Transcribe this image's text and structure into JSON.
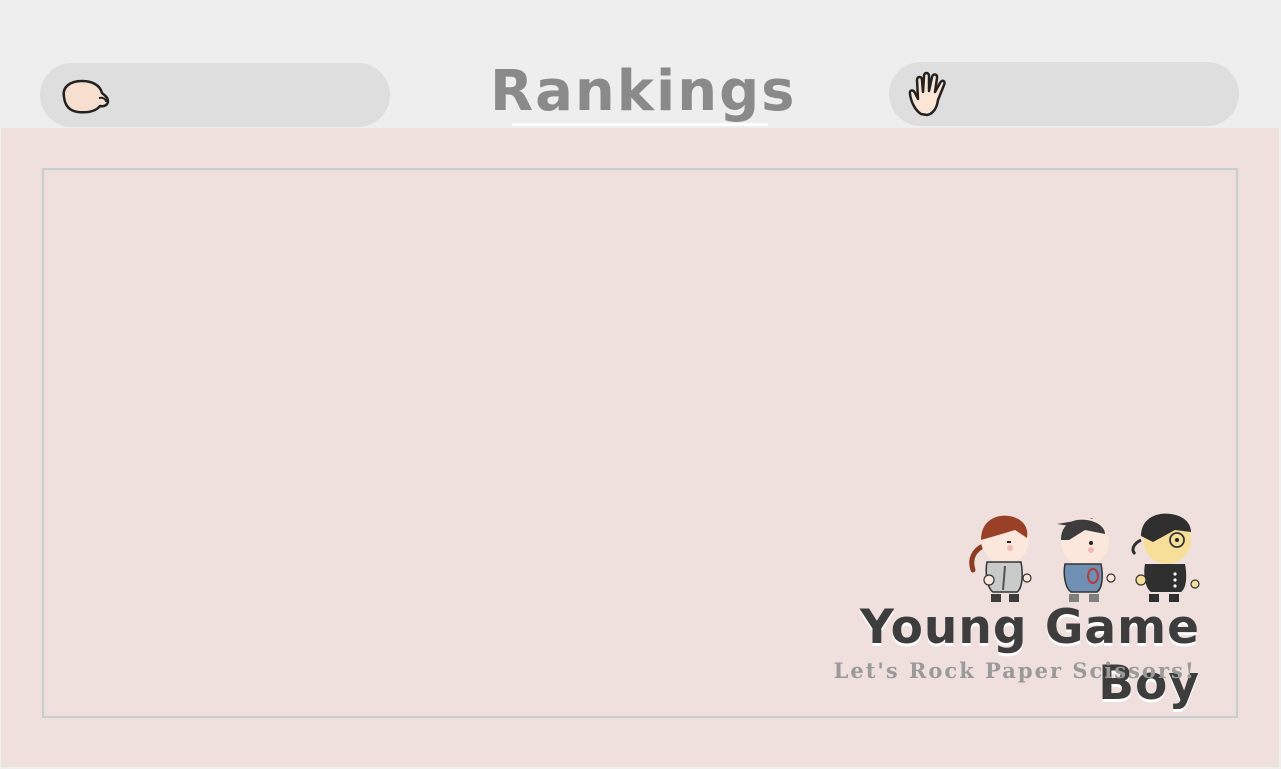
{
  "header": {
    "title": "Rankings",
    "left_icon": "rock-fist-icon",
    "right_icon": "paper-hand-icon"
  },
  "logo": {
    "title": "Young Game Boy",
    "subtitle": "Let's Rock Paper Scissors!",
    "characters": [
      "girl-character",
      "boy-character",
      "glasses-character"
    ]
  },
  "colors": {
    "background": "#eeeeee",
    "pill": "#dddedd",
    "title": "#8a8a8a",
    "panel": "#efe0dd",
    "frame_border": "#c6cfcf",
    "logo_title": "#3d3d3d",
    "logo_subtitle": "#9a9a9a"
  }
}
